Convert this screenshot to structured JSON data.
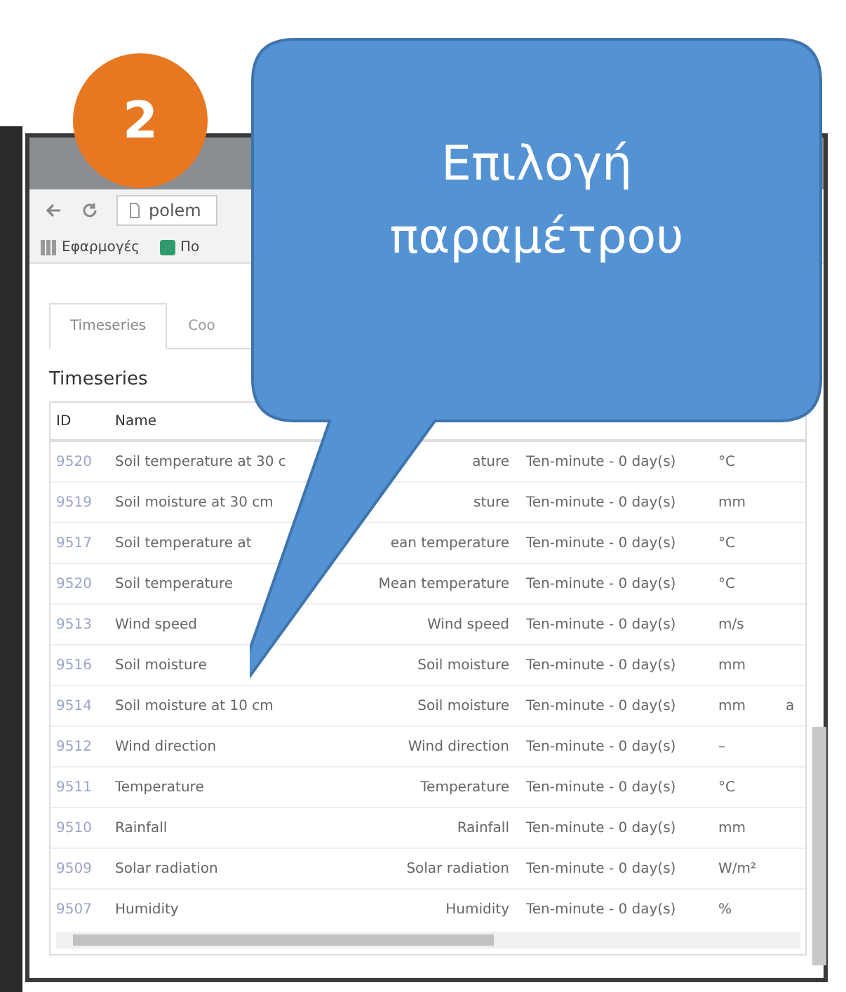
{
  "badge": {
    "number": "2"
  },
  "callout": {
    "lines": [
      "Επιλογή",
      "παραμέτρου"
    ]
  },
  "browser": {
    "address": "polem",
    "bookmarks": [
      {
        "label": "Εφαρμογές"
      },
      {
        "label": "Πο"
      }
    ]
  },
  "tabs": [
    {
      "label": "Timeseries",
      "selected": true
    },
    {
      "label": "Coo",
      "selected": false
    }
  ],
  "heading": "Timeseries",
  "table": {
    "columns": [
      "ID",
      "Name"
    ],
    "rows": [
      {
        "id": "9520",
        "name": "Soil temperature at 30 c",
        "variable": "ature",
        "time_step": "Ten-minute - 0 day(s)",
        "unit": "°C"
      },
      {
        "id": "9519",
        "name": "Soil moisture at 30 cm",
        "variable": "sture",
        "time_step": "Ten-minute - 0 day(s)",
        "unit": "mm"
      },
      {
        "id": "9517",
        "name": "Soil temperature at",
        "variable": "ean temperature",
        "time_step": "Ten-minute - 0 day(s)",
        "unit": "°C"
      },
      {
        "id": "9520",
        "name": "Soil temperature",
        "variable": "Mean temperature",
        "time_step": "Ten-minute - 0 day(s)",
        "unit": "°C"
      },
      {
        "id": "9513",
        "name": "Wind speed",
        "variable": "Wind speed",
        "time_step": "Ten-minute - 0 day(s)",
        "unit": "m/s"
      },
      {
        "id": "9516",
        "name": "Soil moisture",
        "variable": "Soil moisture",
        "time_step": "Ten-minute - 0 day(s)",
        "unit": "mm"
      },
      {
        "id": "9514",
        "name": "Soil moisture at 10 cm",
        "variable": "Soil moisture",
        "time_step": "Ten-minute - 0 day(s)",
        "unit": "mm",
        "extra": "a"
      },
      {
        "id": "9512",
        "name": "Wind direction",
        "variable": "Wind direction",
        "time_step": "Ten-minute - 0 day(s)",
        "unit": "–"
      },
      {
        "id": "9511",
        "name": "Temperature",
        "variable": "Temperature",
        "time_step": "Ten-minute - 0 day(s)",
        "unit": "°C"
      },
      {
        "id": "9510",
        "name": "Rainfall",
        "variable": "Rainfall",
        "time_step": "Ten-minute - 0 day(s)",
        "unit": "mm"
      },
      {
        "id": "9509",
        "name": "Solar radiation",
        "variable": "Solar radiation",
        "time_step": "Ten-minute - 0 day(s)",
        "unit": "W/m²"
      },
      {
        "id": "9507",
        "name": "Humidity",
        "variable": "Humidity",
        "time_step": "Ten-minute - 0 day(s)",
        "unit": "%"
      }
    ]
  }
}
